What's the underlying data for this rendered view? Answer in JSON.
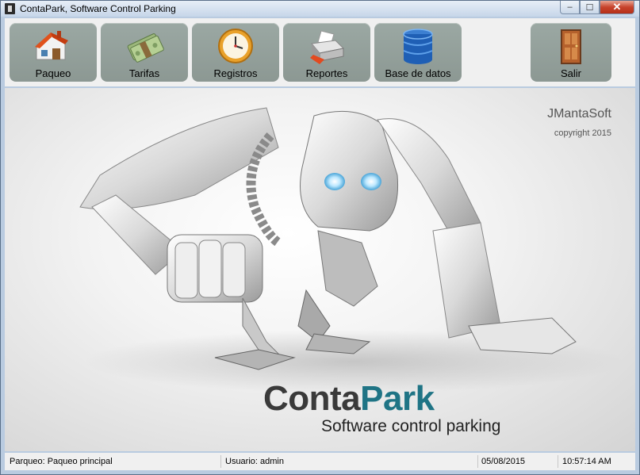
{
  "window": {
    "title": "ContaPark, Software Control Parking",
    "minimize_glyph": "‒",
    "maximize_glyph": "☐",
    "close_glyph": "✕"
  },
  "toolbar": {
    "parqueo": "Paqueo",
    "tarifas": "Tarifas",
    "registros": "Registros",
    "reportes": "Reportes",
    "base_datos": "Base de datos",
    "salir": "Salir"
  },
  "splash": {
    "company": "JMantaSoft",
    "copyright": "copyright 2015",
    "logo_part1": "Conta",
    "logo_part2": "Park",
    "tagline": "Software control parking"
  },
  "status": {
    "parqueo": "Parqueo: Paqueo principal",
    "usuario": "Usuario:  admin",
    "date": "05/08/2015",
    "time": "10:57:14 AM"
  },
  "colors": {
    "toolbar_button": "#939f9a",
    "logo_accent": "#1f7485",
    "logo_dark": "#3a3a3a"
  },
  "icons": [
    "house-icon",
    "money-icon",
    "clock-icon",
    "printer-icon",
    "database-icon",
    "door-icon"
  ]
}
